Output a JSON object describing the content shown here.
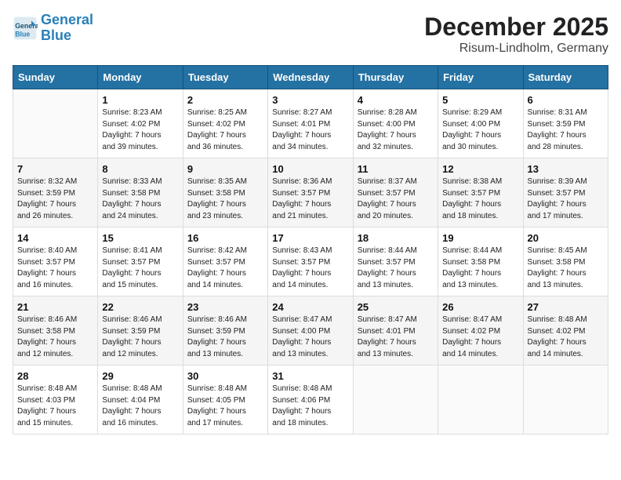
{
  "header": {
    "logo_line1": "General",
    "logo_line2": "Blue",
    "month": "December 2025",
    "location": "Risum-Lindholm, Germany"
  },
  "days_of_week": [
    "Sunday",
    "Monday",
    "Tuesday",
    "Wednesday",
    "Thursday",
    "Friday",
    "Saturday"
  ],
  "weeks": [
    [
      {
        "day": "",
        "info": ""
      },
      {
        "day": "1",
        "info": "Sunrise: 8:23 AM\nSunset: 4:02 PM\nDaylight: 7 hours\nand 39 minutes."
      },
      {
        "day": "2",
        "info": "Sunrise: 8:25 AM\nSunset: 4:02 PM\nDaylight: 7 hours\nand 36 minutes."
      },
      {
        "day": "3",
        "info": "Sunrise: 8:27 AM\nSunset: 4:01 PM\nDaylight: 7 hours\nand 34 minutes."
      },
      {
        "day": "4",
        "info": "Sunrise: 8:28 AM\nSunset: 4:00 PM\nDaylight: 7 hours\nand 32 minutes."
      },
      {
        "day": "5",
        "info": "Sunrise: 8:29 AM\nSunset: 4:00 PM\nDaylight: 7 hours\nand 30 minutes."
      },
      {
        "day": "6",
        "info": "Sunrise: 8:31 AM\nSunset: 3:59 PM\nDaylight: 7 hours\nand 28 minutes."
      }
    ],
    [
      {
        "day": "7",
        "info": "Sunrise: 8:32 AM\nSunset: 3:59 PM\nDaylight: 7 hours\nand 26 minutes."
      },
      {
        "day": "8",
        "info": "Sunrise: 8:33 AM\nSunset: 3:58 PM\nDaylight: 7 hours\nand 24 minutes."
      },
      {
        "day": "9",
        "info": "Sunrise: 8:35 AM\nSunset: 3:58 PM\nDaylight: 7 hours\nand 23 minutes."
      },
      {
        "day": "10",
        "info": "Sunrise: 8:36 AM\nSunset: 3:57 PM\nDaylight: 7 hours\nand 21 minutes."
      },
      {
        "day": "11",
        "info": "Sunrise: 8:37 AM\nSunset: 3:57 PM\nDaylight: 7 hours\nand 20 minutes."
      },
      {
        "day": "12",
        "info": "Sunrise: 8:38 AM\nSunset: 3:57 PM\nDaylight: 7 hours\nand 18 minutes."
      },
      {
        "day": "13",
        "info": "Sunrise: 8:39 AM\nSunset: 3:57 PM\nDaylight: 7 hours\nand 17 minutes."
      }
    ],
    [
      {
        "day": "14",
        "info": "Sunrise: 8:40 AM\nSunset: 3:57 PM\nDaylight: 7 hours\nand 16 minutes."
      },
      {
        "day": "15",
        "info": "Sunrise: 8:41 AM\nSunset: 3:57 PM\nDaylight: 7 hours\nand 15 minutes."
      },
      {
        "day": "16",
        "info": "Sunrise: 8:42 AM\nSunset: 3:57 PM\nDaylight: 7 hours\nand 14 minutes."
      },
      {
        "day": "17",
        "info": "Sunrise: 8:43 AM\nSunset: 3:57 PM\nDaylight: 7 hours\nand 14 minutes."
      },
      {
        "day": "18",
        "info": "Sunrise: 8:44 AM\nSunset: 3:57 PM\nDaylight: 7 hours\nand 13 minutes."
      },
      {
        "day": "19",
        "info": "Sunrise: 8:44 AM\nSunset: 3:58 PM\nDaylight: 7 hours\nand 13 minutes."
      },
      {
        "day": "20",
        "info": "Sunrise: 8:45 AM\nSunset: 3:58 PM\nDaylight: 7 hours\nand 13 minutes."
      }
    ],
    [
      {
        "day": "21",
        "info": "Sunrise: 8:46 AM\nSunset: 3:58 PM\nDaylight: 7 hours\nand 12 minutes."
      },
      {
        "day": "22",
        "info": "Sunrise: 8:46 AM\nSunset: 3:59 PM\nDaylight: 7 hours\nand 12 minutes."
      },
      {
        "day": "23",
        "info": "Sunrise: 8:46 AM\nSunset: 3:59 PM\nDaylight: 7 hours\nand 13 minutes."
      },
      {
        "day": "24",
        "info": "Sunrise: 8:47 AM\nSunset: 4:00 PM\nDaylight: 7 hours\nand 13 minutes."
      },
      {
        "day": "25",
        "info": "Sunrise: 8:47 AM\nSunset: 4:01 PM\nDaylight: 7 hours\nand 13 minutes."
      },
      {
        "day": "26",
        "info": "Sunrise: 8:47 AM\nSunset: 4:02 PM\nDaylight: 7 hours\nand 14 minutes."
      },
      {
        "day": "27",
        "info": "Sunrise: 8:48 AM\nSunset: 4:02 PM\nDaylight: 7 hours\nand 14 minutes."
      }
    ],
    [
      {
        "day": "28",
        "info": "Sunrise: 8:48 AM\nSunset: 4:03 PM\nDaylight: 7 hours\nand 15 minutes."
      },
      {
        "day": "29",
        "info": "Sunrise: 8:48 AM\nSunset: 4:04 PM\nDaylight: 7 hours\nand 16 minutes."
      },
      {
        "day": "30",
        "info": "Sunrise: 8:48 AM\nSunset: 4:05 PM\nDaylight: 7 hours\nand 17 minutes."
      },
      {
        "day": "31",
        "info": "Sunrise: 8:48 AM\nSunset: 4:06 PM\nDaylight: 7 hours\nand 18 minutes."
      },
      {
        "day": "",
        "info": ""
      },
      {
        "day": "",
        "info": ""
      },
      {
        "day": "",
        "info": ""
      }
    ]
  ]
}
